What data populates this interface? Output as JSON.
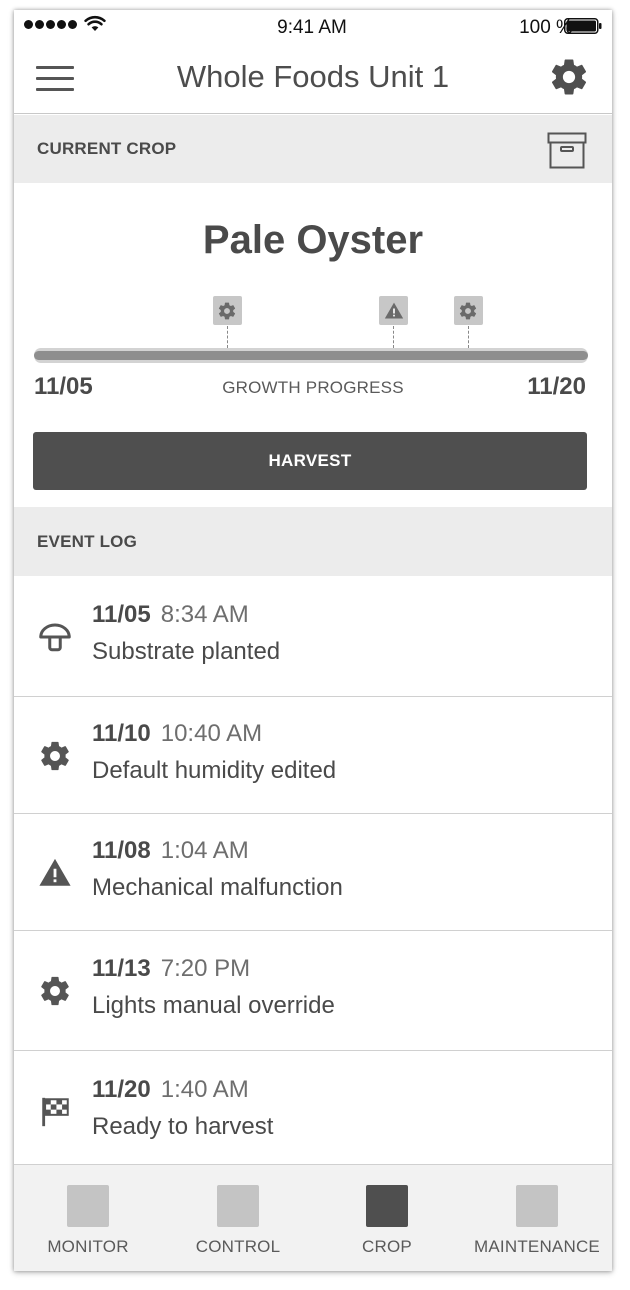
{
  "status_bar": {
    "time": "9:41 AM",
    "battery": "100 %"
  },
  "nav": {
    "title": "Whole Foods Unit 1"
  },
  "current_crop": {
    "section_label": "CURRENT CROP",
    "name": "Pale Oyster",
    "start_date": "11/05",
    "end_date": "11/20",
    "progress_label": "GROWTH PROGRESS",
    "progress_fraction": 1.0,
    "markers": [
      {
        "icon": "gear-icon",
        "position_fraction": 0.35
      },
      {
        "icon": "warning-icon",
        "position_fraction": 0.65
      },
      {
        "icon": "gear-icon",
        "position_fraction": 0.785
      }
    ],
    "harvest_label": "HARVEST"
  },
  "event_log": {
    "section_label": "EVENT LOG",
    "events": [
      {
        "icon": "mushroom-icon",
        "date": "11/05",
        "time": "8:34 AM",
        "description": "Substrate planted"
      },
      {
        "icon": "gear-icon",
        "date": "11/10",
        "time": "10:40 AM",
        "description": "Default humidity edited"
      },
      {
        "icon": "warning-icon",
        "date": "11/08",
        "time": "1:04 AM",
        "description": "Mechanical malfunction"
      },
      {
        "icon": "gear-icon",
        "date": "11/13",
        "time": "7:20 PM",
        "description": "Lights manual override"
      },
      {
        "icon": "checkered-flag-icon",
        "date": "11/20",
        "time": "1:40 AM",
        "description": "Ready to harvest"
      }
    ]
  },
  "tabs": [
    {
      "label": "MONITOR",
      "active": false
    },
    {
      "label": "CONTROL",
      "active": false
    },
    {
      "label": "CROP",
      "active": true
    },
    {
      "label": "MAINTENANCE",
      "active": false
    }
  ],
  "colors": {
    "dark": "#4f4f4f",
    "inactive_tab": "#c4c4c4",
    "section_bg": "#ececec"
  }
}
